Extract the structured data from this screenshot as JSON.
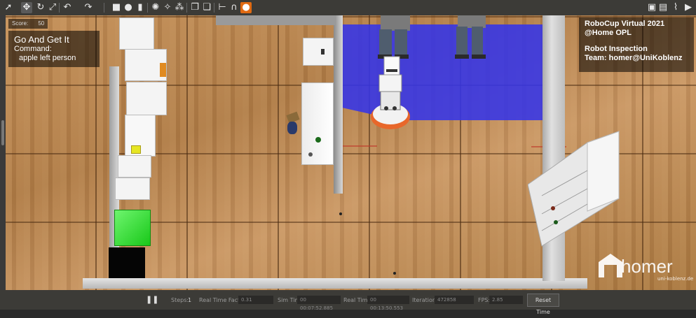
{
  "toolbar": {
    "icons": [
      "select-arrow-icon",
      "translate-icon",
      "rotate-icon",
      "scale-icon",
      "undo-icon",
      "redo-icon",
      "box-shape-icon",
      "sphere-shape-icon",
      "cylinder-shape-icon",
      "point-light-icon",
      "spot-light-icon",
      "directional-light-icon",
      "copy-icon",
      "paste-icon",
      "align-icon",
      "snap-icon",
      "record-icon"
    ],
    "right_icons": [
      "screenshot-icon",
      "log-icon",
      "plot-icon",
      "video-icon"
    ]
  },
  "score": {
    "label": "Score:",
    "value": "50"
  },
  "task": {
    "title": "Go And Get It",
    "command_label": "Command:",
    "command": "apple left person"
  },
  "info": {
    "line1": "RoboCup Virtual 2021",
    "line2": "@Home OPL",
    "line3": "Robot Inspection",
    "line4": "Team: homer@UniKoblenz"
  },
  "logo": {
    "text": "homer",
    "subtext": "uni-koblenz.de"
  },
  "statusbar": {
    "steps_label": "Steps:",
    "steps_value": "1",
    "real_time_factor_label": "Real Time Factor:",
    "real_time_factor_value": "0.31",
    "sim_time_label": "Sim Time:",
    "sim_time_value": "00 00:07:52.885",
    "real_time_label": "Real Time:",
    "real_time_value": "00 00:13:50.553",
    "iterations_label": "Iterations:",
    "iterations_value": "472858",
    "fps_label": "FPS:",
    "fps_value": "2.85",
    "reset_label": "Reset Time"
  },
  "colors": {
    "toolbar_bg": "#3c3b37",
    "floor": "#b6844f",
    "laser_blue": "#3434e8",
    "green_box": "#22dd22",
    "black_box": "#050505"
  }
}
